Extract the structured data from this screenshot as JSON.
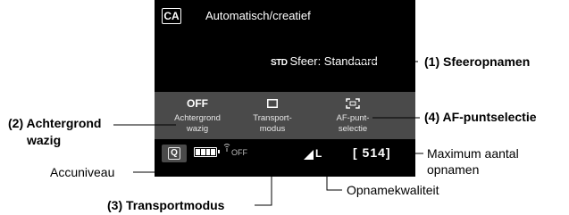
{
  "screen": {
    "mode_icon": "CA",
    "mode_title": "Automatisch/creatief",
    "ambience_icon": "STD",
    "ambience_text": "Sfeer: Standaard",
    "settings": [
      {
        "value": "OFF",
        "icon": "",
        "label1": "Achtergrond",
        "label2": "wazig"
      },
      {
        "value": "",
        "icon": "single-shot-icon",
        "label1": "Transport-",
        "label2": "modus"
      },
      {
        "value": "",
        "icon": "af-frame-icon",
        "label1": "AF-punt-",
        "label2": "selectie"
      }
    ],
    "q_button": "Q",
    "wifi_text": "OFF",
    "quality_text": "L",
    "shots_remaining": "[ 514]"
  },
  "callouts": {
    "sfeeropnamen": "(1) Sfeeropnamen",
    "achtergrond_line1": "(2) Achtergrond",
    "achtergrond_line2": "wazig",
    "af_puntselectie": "(4) AF-puntselectie",
    "maximum_line1": "Maximum aantal",
    "maximum_line2": "opnamen",
    "accuniveau": "Accuniveau",
    "opnamekwaliteit": "Opnamekwaliteit",
    "transportmodus": "(3) Transportmodus"
  }
}
